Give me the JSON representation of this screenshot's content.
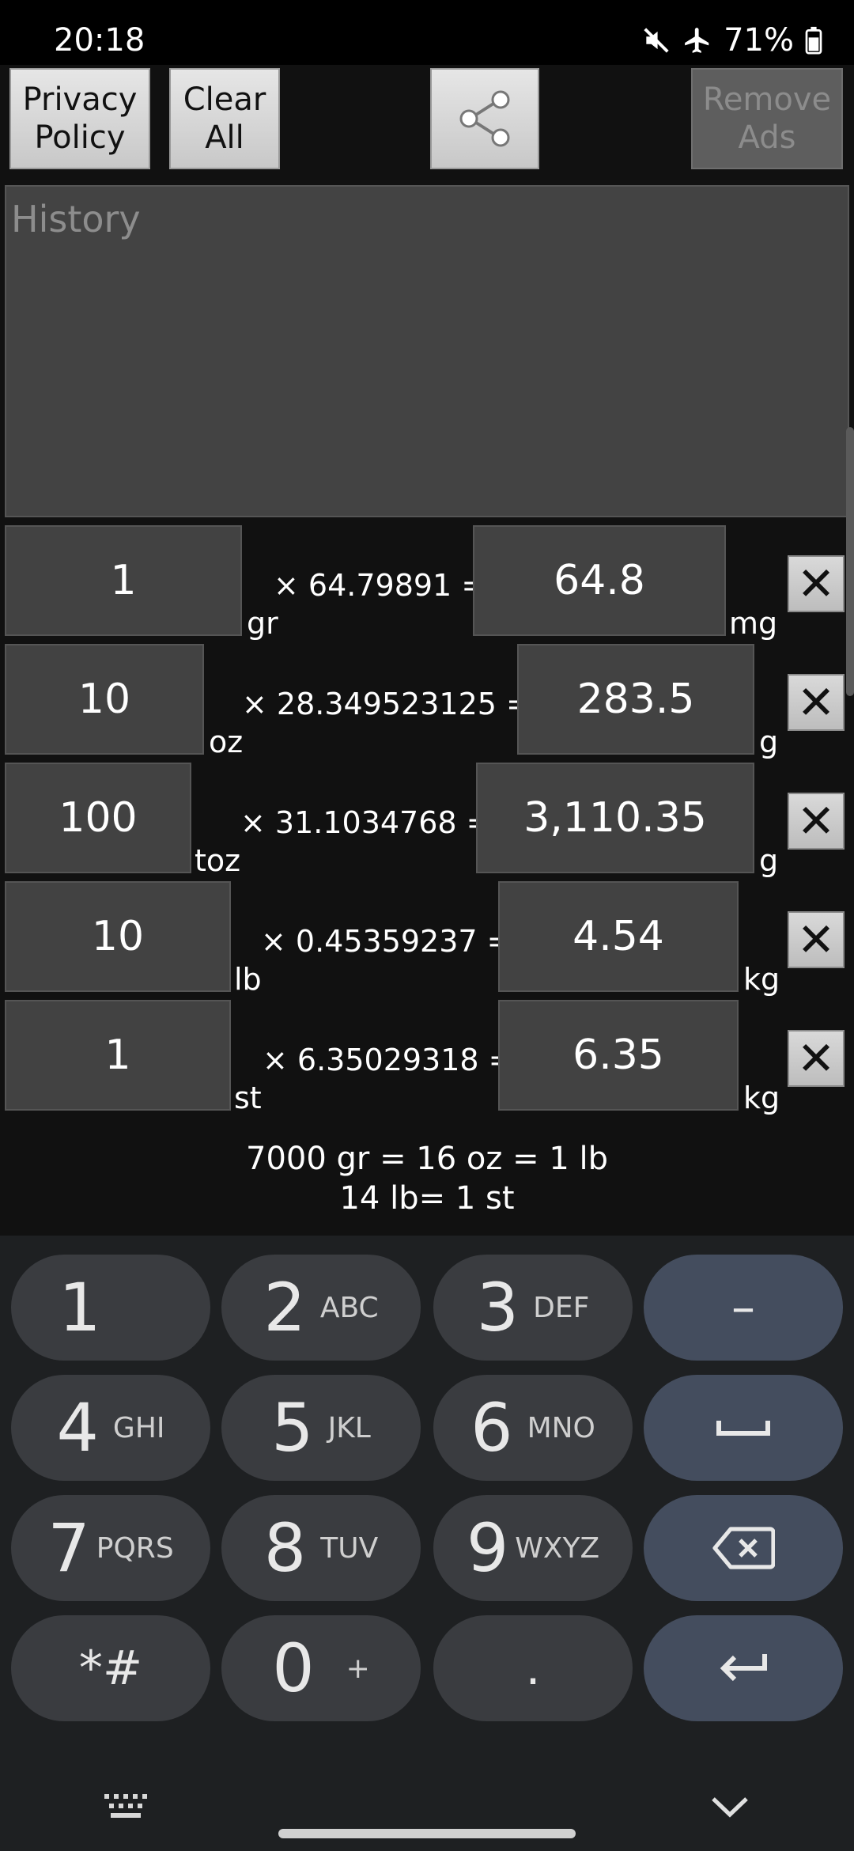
{
  "status_bar": {
    "time": "20:18",
    "battery": "71%",
    "icons": [
      "mute-icon",
      "airplane-icon",
      "battery-icon"
    ]
  },
  "toolbar": {
    "privacy_line1": "Privacy",
    "privacy_line2": "Policy",
    "clear_line1": "Clear",
    "clear_line2": "All",
    "share_icon": "share-icon",
    "remove_line1": "Remove",
    "remove_line2": "Ads"
  },
  "history": {
    "placeholder": "History"
  },
  "conversions": [
    {
      "input": "1",
      "from_unit": "gr",
      "factor": "× 64.79891 =",
      "result": "64.8",
      "to_unit": "mg"
    },
    {
      "input": "10",
      "from_unit": "oz",
      "factor": "× 28.349523125 =",
      "result": "283.5",
      "to_unit": "g"
    },
    {
      "input": "100",
      "from_unit": "toz",
      "factor": "× 31.1034768 =",
      "result": "3,110.35",
      "to_unit": "g"
    },
    {
      "input": "10",
      "from_unit": "lb",
      "factor": "× 0.45359237 =",
      "result": "4.54",
      "to_unit": "kg"
    },
    {
      "input": "1",
      "from_unit": "st",
      "factor": "× 6.35029318 =",
      "result": "6.35",
      "to_unit": "kg"
    }
  ],
  "delete_label": "✕",
  "note": {
    "line1": "7000 gr = 16 oz = 1 lb",
    "line2": "14 lb= 1 st"
  },
  "keyboard": {
    "keys": [
      {
        "digit": "1",
        "letters": ""
      },
      {
        "digit": "2",
        "letters": "ABC"
      },
      {
        "digit": "3",
        "letters": "DEF"
      },
      {
        "digit": "4",
        "letters": "GHI"
      },
      {
        "digit": "5",
        "letters": "JKL"
      },
      {
        "digit": "6",
        "letters": "MNO"
      },
      {
        "digit": "7",
        "letters": "PQRS"
      },
      {
        "digit": "8",
        "letters": "TUV"
      },
      {
        "digit": "9",
        "letters": "WXYZ"
      },
      {
        "digit": "*#",
        "letters": ""
      },
      {
        "digit": "0",
        "letters": "+"
      },
      {
        "digit": ".",
        "letters": ""
      }
    ],
    "minus": "–",
    "space_icon": "space-icon",
    "backspace_icon": "backspace-icon",
    "enter_icon": "enter-icon",
    "keyboard_switch_icon": "keyboard-icon",
    "collapse_icon": "chevron-down-icon"
  },
  "colors": {
    "background": "#111111",
    "field": "#424242",
    "key": "#3a3c40",
    "action_key": "#444d5e"
  }
}
